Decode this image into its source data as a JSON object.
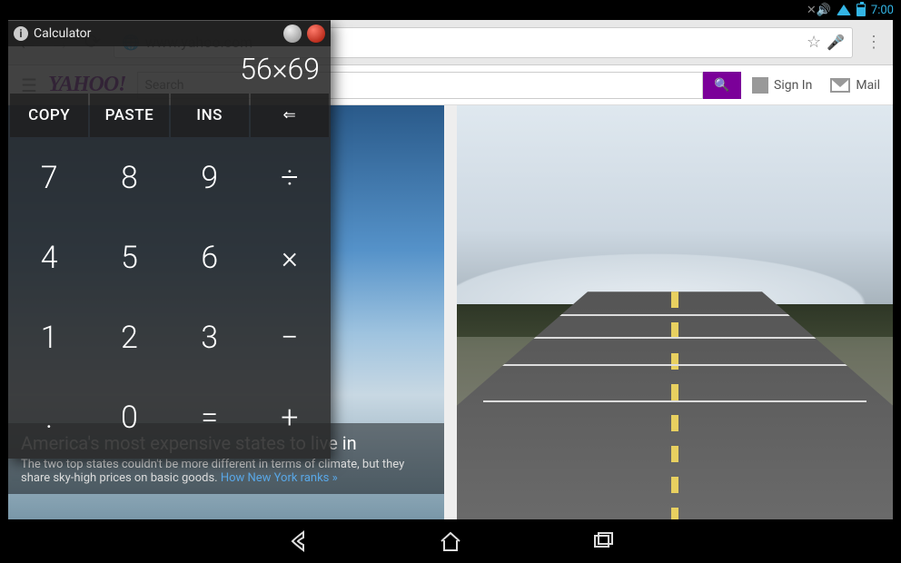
{
  "statusbar": {
    "time": "7:00"
  },
  "browser": {
    "url": "www.yahoo.com"
  },
  "yahoo": {
    "logo": "YAHOO!",
    "search_placeholder": "Search",
    "signin": "Sign In",
    "mail": "Mail",
    "article": {
      "headline": "America's most expensive states to live in",
      "blurb": "The two top states couldn't be more different in terms of climate, but they share sky-high prices on basic goods.",
      "link": "How New York ranks »"
    }
  },
  "calc": {
    "title": "Calculator",
    "display": "56×69",
    "toprow": [
      "COPY",
      "PASTE",
      "INS",
      "⇐"
    ],
    "keys": [
      "7",
      "8",
      "9",
      "÷",
      "4",
      "5",
      "6",
      "×",
      "1",
      "2",
      "3",
      "−",
      ".",
      "0",
      "=",
      "+"
    ]
  }
}
